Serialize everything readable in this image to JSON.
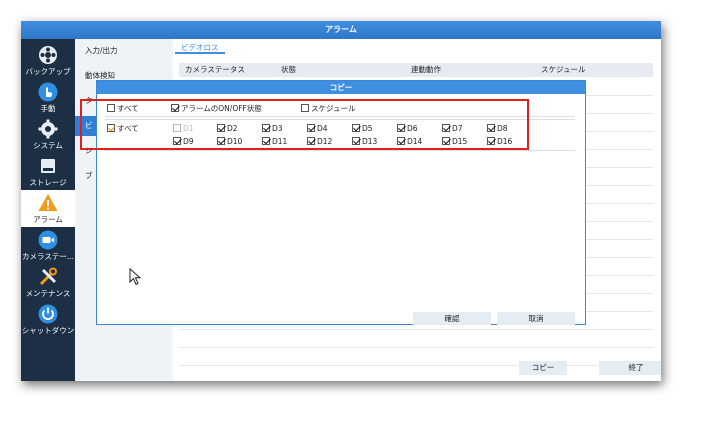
{
  "window": {
    "title": "アラーム"
  },
  "sidebar": {
    "items": [
      {
        "label": "バックアップ",
        "icon": "film-reel-icon"
      },
      {
        "label": "手動",
        "icon": "hand-pointer-icon"
      },
      {
        "label": "システム",
        "icon": "gear-icon"
      },
      {
        "label": "ストレージ",
        "icon": "storage-icon"
      },
      {
        "label": "アラーム",
        "icon": "warning-icon"
      },
      {
        "label": "カメラステー...",
        "icon": "camera-icon"
      },
      {
        "label": "メンテナンス",
        "icon": "tools-icon"
      },
      {
        "label": "シャットダウン",
        "icon": "power-icon"
      }
    ]
  },
  "submenu": {
    "items": [
      "入力/出力",
      "動体検知",
      "タ",
      "ビ",
      "シ",
      "ブ"
    ]
  },
  "main": {
    "tab": "ビデオロス",
    "columns": [
      "カメラステータス",
      "状態",
      "連動動作",
      "スケジュール"
    ],
    "copy_label": "コピー",
    "exit_label": "終了"
  },
  "dialog": {
    "title": "コピー",
    "options": [
      {
        "label": "すべて",
        "checked": false
      },
      {
        "label": "アラームのON/OFF状態",
        "checked": true
      },
      {
        "label": "スケジュール",
        "checked": false
      }
    ],
    "channels_all_label": "すべて",
    "channels": [
      {
        "label": "D1",
        "checked": false,
        "disabled": true
      },
      {
        "label": "D2",
        "checked": true
      },
      {
        "label": "D3",
        "checked": true
      },
      {
        "label": "D4",
        "checked": true
      },
      {
        "label": "D5",
        "checked": true
      },
      {
        "label": "D6",
        "checked": true
      },
      {
        "label": "D7",
        "checked": true
      },
      {
        "label": "D8",
        "checked": true
      },
      {
        "label": "D9",
        "checked": true
      },
      {
        "label": "D10",
        "checked": true
      },
      {
        "label": "D11",
        "checked": true
      },
      {
        "label": "D12",
        "checked": true
      },
      {
        "label": "D13",
        "checked": true
      },
      {
        "label": "D14",
        "checked": true
      },
      {
        "label": "D15",
        "checked": true
      },
      {
        "label": "D16",
        "checked": true
      }
    ],
    "ok_label": "確認",
    "cancel_label": "取消"
  },
  "colors": {
    "accent": "#3f8ee0",
    "sidebar": "#1c2f44",
    "highlight": "#e0201e",
    "warning": "#f39a1e"
  }
}
